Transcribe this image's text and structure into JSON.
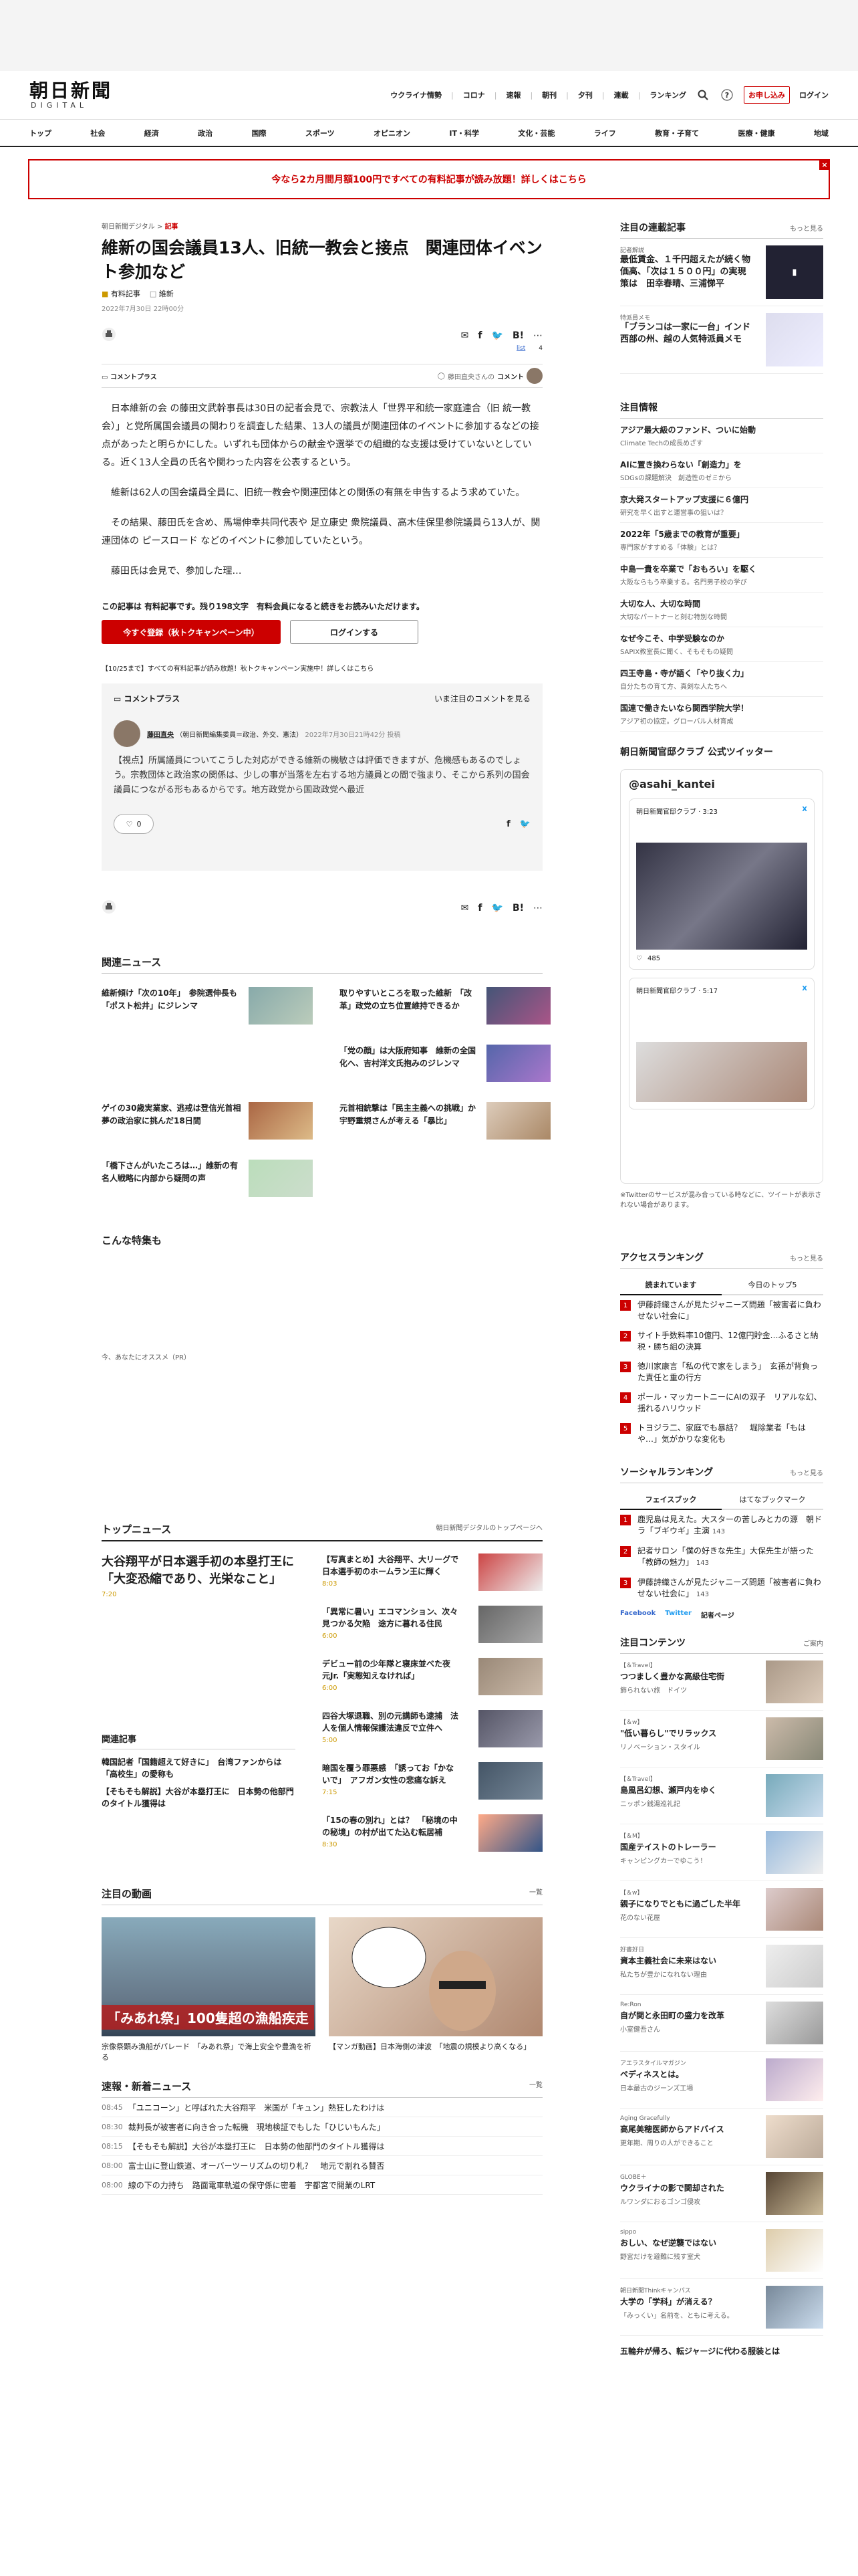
{
  "header": {
    "logo": "朝日新聞",
    "logo_sub": "DIGITAL",
    "links": [
      "ウクライナ情勢",
      "コロナ",
      "速報",
      "朝刊",
      "夕刊",
      "連載",
      "ランキング"
    ],
    "subscribe": "お申し込み",
    "login": "ログイン"
  },
  "categories": [
    "トップ",
    "社会",
    "経済",
    "政治",
    "国際",
    "スポーツ",
    "オピニオン",
    "IT・科学",
    "文化・芸能",
    "ライフ",
    "教育・子育て",
    "医療・健康",
    "地域"
  ],
  "banner": "今なら2カ月間月額100円ですべての有料記事が読み放題！詳しくはこちら",
  "article": {
    "breadcrumb1": "朝日新聞デジタル",
    "breadcrumb2": "記事",
    "title": "維新の国会議員13人、旧統一教会と接点　関連団体イベント参加など",
    "tag_paid": "有料記事",
    "tag_topic": "維新",
    "date": "2022年7月30日 22時00分",
    "list_label": "list",
    "list_count": "4",
    "commentplus": "コメントプラス",
    "commenter_note": "藤田直央さんの",
    "comment_label": "コメント",
    "p1": "日本維新の会 の藤田文武幹事長は30日の記者会見で、宗教法人「世界平和統一家庭連合（旧 統一教会）」と党所属国会議員の関わりを調査した結果、13人の議員が関連団体のイベントに参加するなどの接点があったと明らかにした。いずれも団体からの献金や選挙での組織的な支援は受けていないとしている。近く13人全員の氏名や関わった内容を公表するという。",
    "p2": "維新は62人の国会議員全員に、旧統一教会や関連団体との関係の有無を申告するよう求めていた。",
    "p3": "その結果、藤田氏を含め、馬場伸幸共同代表や 足立康史 衆院議員、高木佳保里参院議員ら13人が、関連団体の ピースロード などのイベントに参加していたという。",
    "p4": "藤田氏は会見で、参加した理…",
    "paywall": "この記事は 有料記事です。残り198文字　有料会員になると続きをお読みいただけます。",
    "paywall_highlight": "有料記事",
    "btn_register": "今すぐ登録（秋トクキャンペーン中）",
    "btn_login": "ログインする",
    "campaign": "【10/25まで】すべての有料記事が読み放題！秋トクキャンペーン実施中！詳しくはこちら",
    "cp_title": "コメントプラス",
    "cp_prompt": "いま注目のコメントを見る",
    "cp_name": "藤田直央",
    "cp_role": "（朝日新聞編集委員＝政治、外交、憲法）",
    "cp_date": "2022年7月30日21時42分 投稿",
    "cp_text": "【視点】所属議員についてこうした対応ができる維新の機敏さは評価できますが、危機感もあるのでしょう。宗教団体と政治家の関係は、少しの事が当落を左右する地方議員との間で強まり、そこから系列の国会議員につながる形もあるからです。地方政党から国政政党へ最近",
    "likes": "0"
  },
  "related": {
    "title": "関連ニュース",
    "items": [
      "維新傾け「次の10年」　参院選伸長も「ポスト松井」にジレンマ",
      "取りやすいところを取った維新　「改革」政党の立ち位置維持できるか",
      "「党の顔」は大阪府知事　維新の全国化へ、吉村洋文氏抱みのジレンマ",
      "ゲイの30歳実業家、逃戒は登信光首相　夢の政治家に挑んだ18日間",
      "元首相銃撃は「民主主義への挑戦」か　宇野重規さんが考える「暴比」",
      "「橋下さんがいたころは…」維新の有名人戦略に内部から疑問の声"
    ]
  },
  "special": {
    "title": "こんな特集も",
    "recommend": "今、あなたにオススメ（PR）"
  },
  "topnews": {
    "title": "トップニュース",
    "link": "朝日新聞デジタルのトップページへ",
    "lead": "大谷翔平が日本選手初の本塁打王に「大変恐縮であり、光栄なこと」",
    "lead_time": "7:20",
    "related_title": "関連記事",
    "related": [
      "韓国記者「国籍超えて好きに」　台湾ファンからは「高校生」の愛称も",
      "【そもそも解説】大谷が本塁打王に　日本勢の他部門のタイトル獲得は"
    ],
    "items": [
      {
        "t": "【写真まとめ】大谷翔平、大リーグで日本選手初のホームラン王に輝く",
        "d": "8:03"
      },
      {
        "t": "「異常に暑い」エコマンション、次々見つかる欠陥　途方に暮れる住民",
        "d": "6:00"
      },
      {
        "t": "デビュー前の少年隊と寝床並べた夜　元Jr.「実態知えなければ」",
        "d": "6:00"
      },
      {
        "t": "四谷大塚退職、別の元講師も逮捕　法人を個人情報保護法違反で立件へ",
        "d": "5:00"
      },
      {
        "t": "暗国を覆う罪悪感　「誘ってお「かないで」　アフガン女性の悲痛な訴え",
        "d": "7:15"
      },
      {
        "t": "「15の春の別れ」とは？　「秘境の中の秘境」の村が出てた込む転居補",
        "d": "8:30"
      }
    ]
  },
  "video": {
    "title": "注目の動画",
    "more": "一覧",
    "v1": "「みあれ祭」100隻超の漁船疾走",
    "c1": "宗像祭顕み漁船がパレード　「みあれ祭」で海上安全や豊漁を祈る",
    "c2": "【マンガ動画】日本海側の津波　「地震の規模より高くなる」"
  },
  "breaking": {
    "title": "速報・新着ニュース",
    "more": "一覧",
    "items": [
      {
        "tm": "08:45",
        "t": "「ユニコーン」と呼ばれた大谷翔平　米国が「キュン」熱狂したわけは"
      },
      {
        "tm": "08:30",
        "t": "裁判長が被害者に向き合った転機　現地検証でもした「ひじいもんた」"
      },
      {
        "tm": "08:15",
        "t": "【そもそも解説】大谷が本塁打王に　日本勢の他部門のタイトル獲得は"
      },
      {
        "tm": "08:00",
        "t": "富士山に登山鉄道、オーバーツーリズムの切り札？　地元で割れる賛否"
      },
      {
        "tm": "08:00",
        "t": "線の下の力持ち　路面電車軌道の保守係に密着　宇都宮で開業のLRT"
      }
    ]
  },
  "side": {
    "series": {
      "title": "注目の連載記事",
      "more": "もっと見る",
      "items": [
        {
          "lab": "記者解説",
          "t": "最低賃金、１千円超えたが続く物価高、「次は１５００円」の実現策は　田幸春晴、三浦悌平"
        },
        {
          "lab": "特派員メモ",
          "t": "「ブランコは一家に一台」インド西部の州、越の人気特派員メモ"
        }
      ]
    },
    "attention": {
      "title": "注目情報",
      "items": [
        {
          "t": "アジア最大級のファンド、ついに始動",
          "s": "Climate Techの成長めざす"
        },
        {
          "t": "AIに置き換わらない「創造力」を",
          "s": "SDGsの課題解決　創造性のゼミから"
        },
        {
          "t": "京大発スタートアップ支援に６億円",
          "s": "研究を早く出すと運営事の狙いは？"
        },
        {
          "t": "2022年「5歳までの教育が重要」",
          "s": "専門家がすすめる「体験」とは？"
        },
        {
          "t": "中島一貴を卒業で「おもろい」を駆く",
          "s": "大阪ならもう卒業する。名門男子校の学び"
        },
        {
          "t": "大切な人、大切な時間",
          "s": "大切なパートナーと刻む特別な時間"
        },
        {
          "t": "なぜ今こそ、中学受験なのか",
          "s": "SAPIX教室長に聞く、そもそもの疑問"
        },
        {
          "t": "四王寺島・寺が語く「やり抜く力」",
          "s": "自分たちの育て方、真剣な人たちへ"
        },
        {
          "t": "国連で働きたいなら関西学院大学！",
          "s": "アジア初の協定。グローバル人材育成"
        }
      ]
    },
    "twitter": {
      "title": "朝日新聞官邸クラブ 公式ツイッター",
      "handle": "@asahi_kantei",
      "name": "朝日新聞官邸クラブ",
      "card1_time": "3:23",
      "card2_time": "5:17",
      "likes1": "485",
      "note": "※Twitterのサービスが混み合っている時などに、ツイートが表示されない場合があります。"
    },
    "ranking": {
      "title": "アクセスランキング",
      "more": "もっと見る",
      "tab1": "読まれています",
      "tab2": "今日のトップ5",
      "items": [
        "伊藤詩織さんが見たジャニーズ問題「被害者に負わせない社会に」",
        "サイト手数料率10億円、12億円貯金…ふるさと納税・勝ち組の決算",
        "徳川家康言「私の代で家をしまう」　玄孫が背負った責任と重の行方",
        "ポール・マッカートニーにAIの双子　リアルな幻、揺れるハリウッド",
        "トヨジラ二、家庭でも暴話？　堀除業者「もはや…」気がかりな変化も"
      ]
    },
    "social": {
      "title": "ソーシャルランキング",
      "more": "もっと見る",
      "tab1": "フェイスブック",
      "tab2": "はてなブックマーク",
      "items": [
        "鹿児島は見えた。大スターの苦しみとカの源　朝ドラ「ブギウギ」主演",
        "記者サロン「僕の好きな先生」大保先生が語った「教師の魅力」",
        "伊藤詩織さんが見たジャニーズ問題「被害者に負わせない社会に」"
      ],
      "counts": [
        "143",
        "143",
        "143"
      ],
      "fb": "Facebook",
      "tw": "Twitter",
      "ad": "記者ページ"
    },
    "features": {
      "title": "注目コンテンツ",
      "more": "ご案内",
      "items": [
        {
          "lab": "【＆Travel】",
          "t": "つつましく豊かな高級住宅街",
          "s": "飾られない旅　ドイツ"
        },
        {
          "lab": "【＆w】",
          "t": "\"低い暮らし\"でリラックス",
          "s": "リノベーション・スタイル"
        },
        {
          "lab": "【＆Travel】",
          "t": "島風呂幻想、瀬戸内をゆく",
          "s": "ニッポン銭湯巡礼記"
        },
        {
          "lab": "【＆M】",
          "t": "国産テイストのトレーラー",
          "s": "キャンピングカーでゆこう！"
        },
        {
          "lab": "【＆w】",
          "t": "親子になりでともに過ごした半年",
          "s": "花のない花屋"
        },
        {
          "lab": "好書好日",
          "t": "資本主義社会に未来はない",
          "s": "私たちが豊かになれない理由"
        },
        {
          "lab": "Re:Ron",
          "t": "自が関と永田町の盛力を改革",
          "s": "小室健吾さん"
        },
        {
          "lab": "アエラスタイルマガジン",
          "t": "ペディネスとは。",
          "s": "日本最古のジーンズ工場"
        },
        {
          "lab": "Aging Gracefully",
          "t": "高尾美穂医師からアドバイス",
          "s": "更年期、周りの人ができること"
        },
        {
          "lab": "GLOBE＋",
          "t": "ウクライナの影で関却された",
          "s": "ルワンダにおるゴンゴ侵攻"
        },
        {
          "lab": "sippo",
          "t": "おしい、なぜ逆襲ではない",
          "s": "野宮だけを避難に残す室犬"
        },
        {
          "lab": "朝日新聞Thinkキャンパス",
          "t": "大学の「学科」が消える？",
          "s": "「みっくい」名前を、ともに考える。"
        }
      ]
    },
    "more_bottom": "五輪弁が帰ろ、転ジャージに代わる服装とは"
  }
}
